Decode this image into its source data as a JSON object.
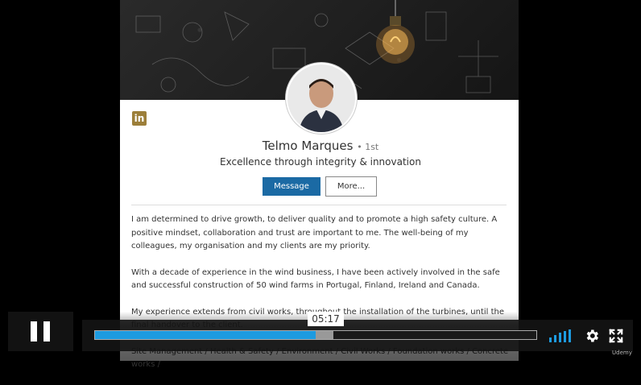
{
  "profile": {
    "name": "Telmo Marques",
    "degree": "• 1st",
    "headline": "Excellence through integrity & innovation",
    "message_label": "Message",
    "more_label": "More...",
    "linkedin_logo": "in"
  },
  "summary": {
    "p1": "I am determined to drive growth, to deliver quality and to promote a high safety culture. A positive mindset, collaboration and trust are important to me. The well-being of my colleagues, my organisation and my clients are my priority.",
    "p2": "With a decade of experience in the wind business, I have been actively involved in the safe and successful construction of 50 wind farms in Portugal, Finland, Ireland and Canada.",
    "p3": "My experience extends from civil works, throughout the installation of the turbines, until the final handover to the client.",
    "p4": "Site Management / Health & Safety / Environment / Civil Works / Foundation works / Concrete works /"
  },
  "player": {
    "time_tooltip": "05:17",
    "progress": 0.5,
    "buffered": 0.54,
    "accent_color": "#1d9be0",
    "watermark": "Udemy"
  },
  "icons": {
    "pause": "pause-icon",
    "volume": "volume-icon",
    "settings": "gear-icon",
    "fullscreen": "fullscreen-icon"
  }
}
